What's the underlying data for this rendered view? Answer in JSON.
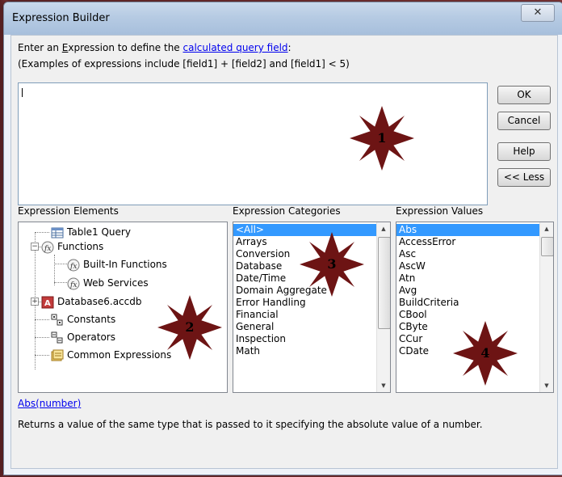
{
  "window": {
    "title": "Expression Builder",
    "close_glyph": "✕"
  },
  "prompt": {
    "line1_prefix": "Enter an ",
    "line1_e": "E",
    "line1_mid": "xpression to define the ",
    "line1_link": "calculated query field",
    "line1_suffix": ":",
    "line2": "(Examples of expressions include [field1] + [field2] and [field1] < 5)"
  },
  "expression_input": {
    "value": ""
  },
  "buttons": {
    "ok": "OK",
    "cancel": "Cancel",
    "help": "Help",
    "less": "<< Less"
  },
  "sections": {
    "elements": "Expression Elements",
    "categories": "Expression Categories",
    "values": "Expression Values"
  },
  "elements_tree": [
    {
      "label": "Table1 Query",
      "icon": "table-query-icon"
    },
    {
      "label": "Functions",
      "icon": "function-icon",
      "expander": "−"
    },
    {
      "label": "Built-In Functions",
      "icon": "function-icon"
    },
    {
      "label": "Web Services",
      "icon": "function-icon"
    },
    {
      "label": "Database6.accdb",
      "icon": "database-icon",
      "expander": "+"
    },
    {
      "label": "Constants",
      "icon": "constants-icon"
    },
    {
      "label": "Operators",
      "icon": "operators-icon"
    },
    {
      "label": "Common Expressions",
      "icon": "common-expressions-icon"
    }
  ],
  "categories": [
    "<All>",
    "Arrays",
    "Conversion",
    "Database",
    "Date/Time",
    "Domain Aggregate",
    "Error Handling",
    "Financial",
    "General",
    "Inspection",
    "Math"
  ],
  "values": [
    "Abs",
    "AccessError",
    "Asc",
    "AscW",
    "Atn",
    "Avg",
    "BuildCriteria",
    "CBool",
    "CByte",
    "CCur",
    "CDate"
  ],
  "description": {
    "link": "Abs(number)",
    "text": "Returns a value of the same type that is passed to it specifying the absolute value of a number."
  },
  "callouts": [
    "1",
    "2",
    "3",
    "4"
  ],
  "colors": {
    "selection": "#3399ff",
    "callout": "#6d1414",
    "link": "#0000ee"
  }
}
